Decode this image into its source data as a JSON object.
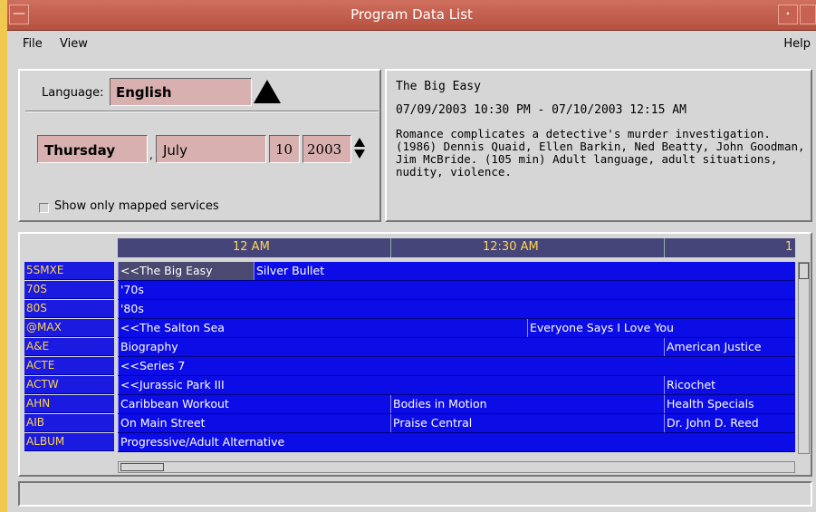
{
  "window": {
    "title": "Program Data List"
  },
  "menu": {
    "file": "File",
    "view": "View",
    "help": "Help"
  },
  "filters": {
    "language_label": "Language:",
    "language": "English",
    "day": "Thursday",
    "comma": ",",
    "month": "July",
    "date": "10",
    "year": "2003",
    "show_mapped_label": "Show only mapped services",
    "show_mapped_checked": false
  },
  "details": {
    "title": "The Big Easy",
    "time_range": "07/09/2003 10:30 PM - 07/10/2003 12:15 AM",
    "description": "Romance complicates a detective's murder investigation. (1986) Dennis Quaid, Ellen Barkin, Ned Beatty, John Goodman, Jim McBride. (105 min) Adult language, adult situations, nudity, violence."
  },
  "timeline": {
    "labels": [
      "12 AM",
      "12:30 AM",
      "1"
    ]
  },
  "guide": {
    "rows": [
      {
        "channel": "5SMXE",
        "programs": [
          {
            "title": "<<The Big Easy",
            "selected": true
          },
          {
            "title": "Silver Bullet"
          }
        ]
      },
      {
        "channel": "70S",
        "programs": [
          {
            "title": "'70s"
          }
        ]
      },
      {
        "channel": "80S",
        "programs": [
          {
            "title": "'80s"
          }
        ]
      },
      {
        "channel": "@MAX",
        "programs": [
          {
            "title": "<<The Salton Sea"
          },
          {
            "title": "Everyone Says I Love You"
          }
        ]
      },
      {
        "channel": "A&E",
        "programs": [
          {
            "title": "Biography"
          },
          {
            "title": "American Justice"
          }
        ]
      },
      {
        "channel": "ACTE",
        "programs": [
          {
            "title": "<<Series 7"
          }
        ]
      },
      {
        "channel": "ACTW",
        "programs": [
          {
            "title": "<<Jurassic Park III"
          },
          {
            "title": "Ricochet"
          }
        ]
      },
      {
        "channel": "AHN",
        "programs": [
          {
            "title": "Caribbean Workout"
          },
          {
            "title": "Bodies in Motion"
          },
          {
            "title": "Health Specials"
          }
        ]
      },
      {
        "channel": "AIB",
        "programs": [
          {
            "title": "On Main Street"
          },
          {
            "title": "Praise Central"
          },
          {
            "title": "Dr. John D. Reed"
          }
        ]
      },
      {
        "channel": "ALBUM",
        "programs": [
          {
            "title": "Progressive/Adult Alternative"
          }
        ]
      }
    ]
  },
  "colors": {
    "titlebar": "#b75140",
    "grid_blue": "#0c0ce6",
    "channel_text": "#ffd54a",
    "field_bg": "#d9b0b0"
  }
}
